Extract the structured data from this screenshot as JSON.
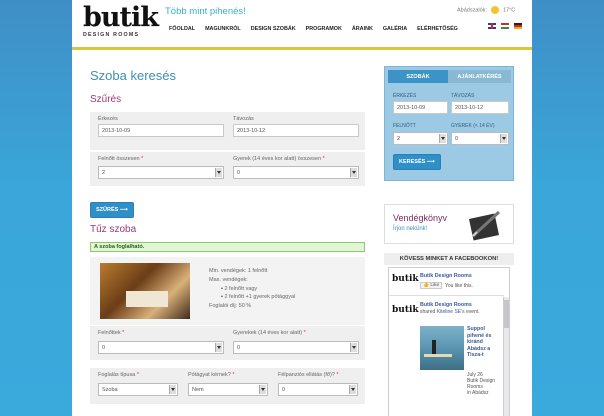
{
  "header": {
    "logo_text": "butik",
    "logo_sub": "DESIGN ROOMS",
    "tagline": "Több mint pihenés!",
    "weather_place": "Abádszalók:",
    "weather_temp": "17°C",
    "nav": [
      "FŐOLDAL",
      "MAGUNKRÓL",
      "DESIGN SZOBÁK",
      "PROGRAMOK",
      "ÁRAINK",
      "GALÉRIA",
      "ELÉRHETŐSÉG"
    ],
    "flag_colors": {
      "en": "#2b3f8f",
      "hu": "#c8312d",
      "de": "#e2b21d"
    }
  },
  "main": {
    "title": "Szoba keresés",
    "filter_heading": "Szűrés",
    "arrival_label": "Érkezés",
    "arrival_value": "2013-10-09",
    "departure_label": "Távozás",
    "departure_value": "2013-10-12",
    "adults_label": "Felnőtt összesen",
    "adults_value": "2",
    "children_label": "Gyerek (14 éves kor alatt) összesen",
    "children_value": "0",
    "filter_button": "SZŰRÉS ⟶",
    "room_heading": "Tűz szoba",
    "availability": "A szoba foglalható.",
    "room_info": {
      "min_guests": "Min. vendégek: 1 felnőtt",
      "max_guests": "Max. vendégek:",
      "option1": "2 felnőtt vagy",
      "option2": "2 felnőtt +1 gyerek pótággyal",
      "deposit": "Foglalói díj: 50 %"
    },
    "adults2_label": "Felnőttek",
    "adults2_value": "0",
    "children2_label": "Gyerekek (14 éves kor alatt)",
    "children2_value": "0",
    "booking_type_label": "Foglalás típusa",
    "booking_type_value": "Szoba",
    "extra_bed_label": "Pótágyat kérnek?",
    "extra_bed_value": "Nem",
    "halfboard_label": "Félpanziós ellátás (fő)?",
    "halfboard_value": "0",
    "required_mark": "*"
  },
  "side": {
    "tab_rooms": "SZOBÁK",
    "tab_offer": "AJÁNLATKÉRÉS",
    "arrival_label": "ÉRKEZÉS",
    "arrival_value": "2013-10-09",
    "departure_label": "TÁVOZÁS",
    "departure_value": "2013-10-12",
    "adults_label": "FELNŐTT",
    "adults_value": "2",
    "children_label": "GYEREK (< 14 ÉV)",
    "children_value": "0",
    "search_button": "KERESÉS ⟶",
    "guestbook_title": "Vendégkönyv",
    "guestbook_sub": "Írjon nekünk!",
    "fb_heading": "KÖVESS MINKET A FACEBOOKON!",
    "fb_page": "Butik Design Rooms",
    "fb_like": "Like",
    "fb_like_this": "You like this.",
    "post_page": "Butik Design Rooms",
    "post_text": "shared",
    "post_person": "Kiteline SE",
    "post_suffix": "'s event.",
    "event_title": "Suppol pihené és kiránd Abádsz a Tisza-t",
    "event_date": "July 26",
    "event_venue": "Butik Design Rooms",
    "event_place": "in Abádsz"
  }
}
